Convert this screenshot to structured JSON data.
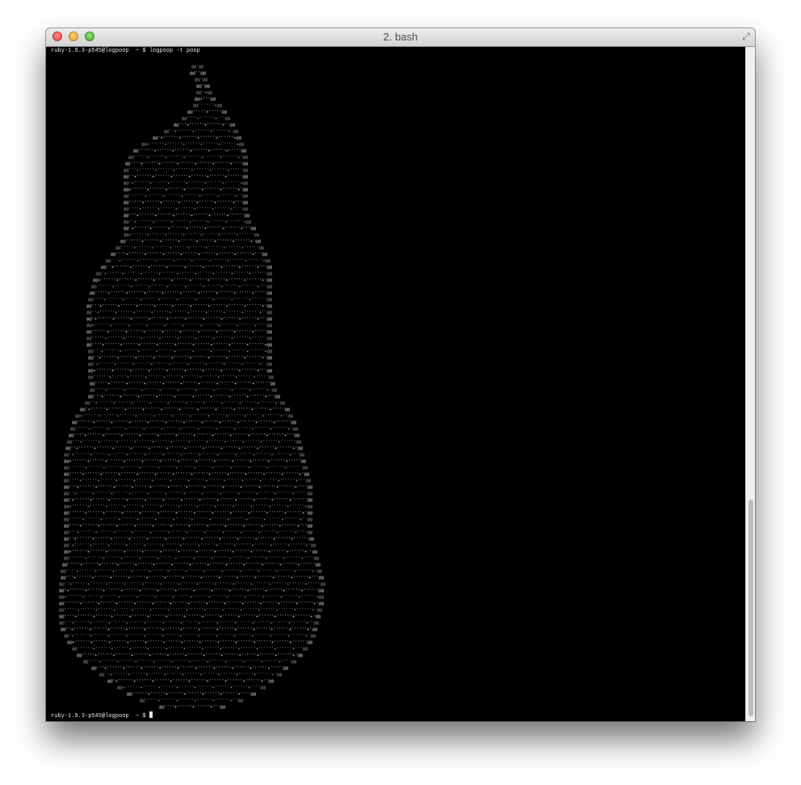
{
  "window": {
    "title": "2. bash",
    "controls": {
      "close_icon": "close-icon",
      "minimize_icon": "minimize-icon",
      "zoom_icon": "zoom-icon",
      "fullscreen_icon": "fullscreen-icon"
    }
  },
  "terminal": {
    "prompt_top": "ruby-1.9.3-p545@logpoop  ~ $ logpoop -t poop",
    "prompt_bottom": "ruby-1.9.3-p545@logpoop  ~ $ ",
    "colors": {
      "background": "#000000",
      "text": "#e6e6e6",
      "art_light": "#c8c8c8",
      "art_dim": "#8a8a8a"
    },
    "ascii_art": {
      "subject": "poop-shaped ascii art",
      "glyphs": [
        "@",
        "'",
        "-",
        "+",
        "#",
        ".",
        ","
      ]
    }
  }
}
